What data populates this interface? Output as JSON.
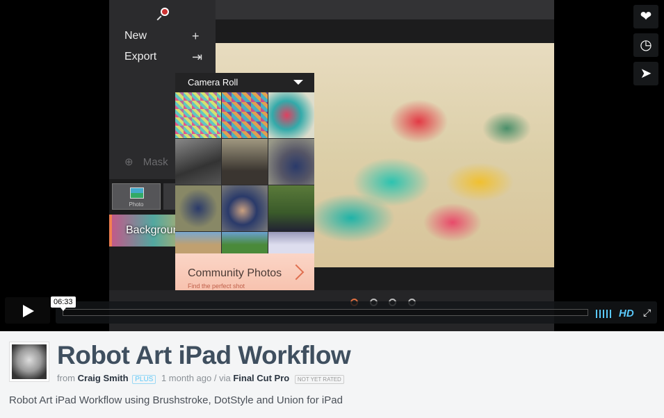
{
  "app": {
    "menu": [
      {
        "label": "New",
        "glyph": "+"
      },
      {
        "label": "Export",
        "glyph": "⇥"
      }
    ],
    "mask_label": "Mask",
    "photo_tile_label": "Photo",
    "background_label": "Background",
    "camera_roll": {
      "title": "Camera Roll",
      "community_title": "Community Photos",
      "community_subtitle": "Find the perfect shot"
    }
  },
  "player": {
    "time": "06:33",
    "progress_percent": 0,
    "hd_label": "HD",
    "side_buttons": [
      "heart-icon",
      "clock-icon",
      "send-icon"
    ]
  },
  "video": {
    "title": "Robot Art iPad Workflow",
    "from": "from",
    "author": "Craig Smith",
    "plus_badge": "PLUS",
    "meta": "1 month ago / via",
    "via": "Final Cut Pro",
    "rating_badge": "NOT YET RATED",
    "description": "Robot Art iPad Workflow using Brushstroke, DotStyle and Union for iPad"
  },
  "colors": {
    "accent": "#5ac8fa",
    "title": "#3f4f5f"
  }
}
